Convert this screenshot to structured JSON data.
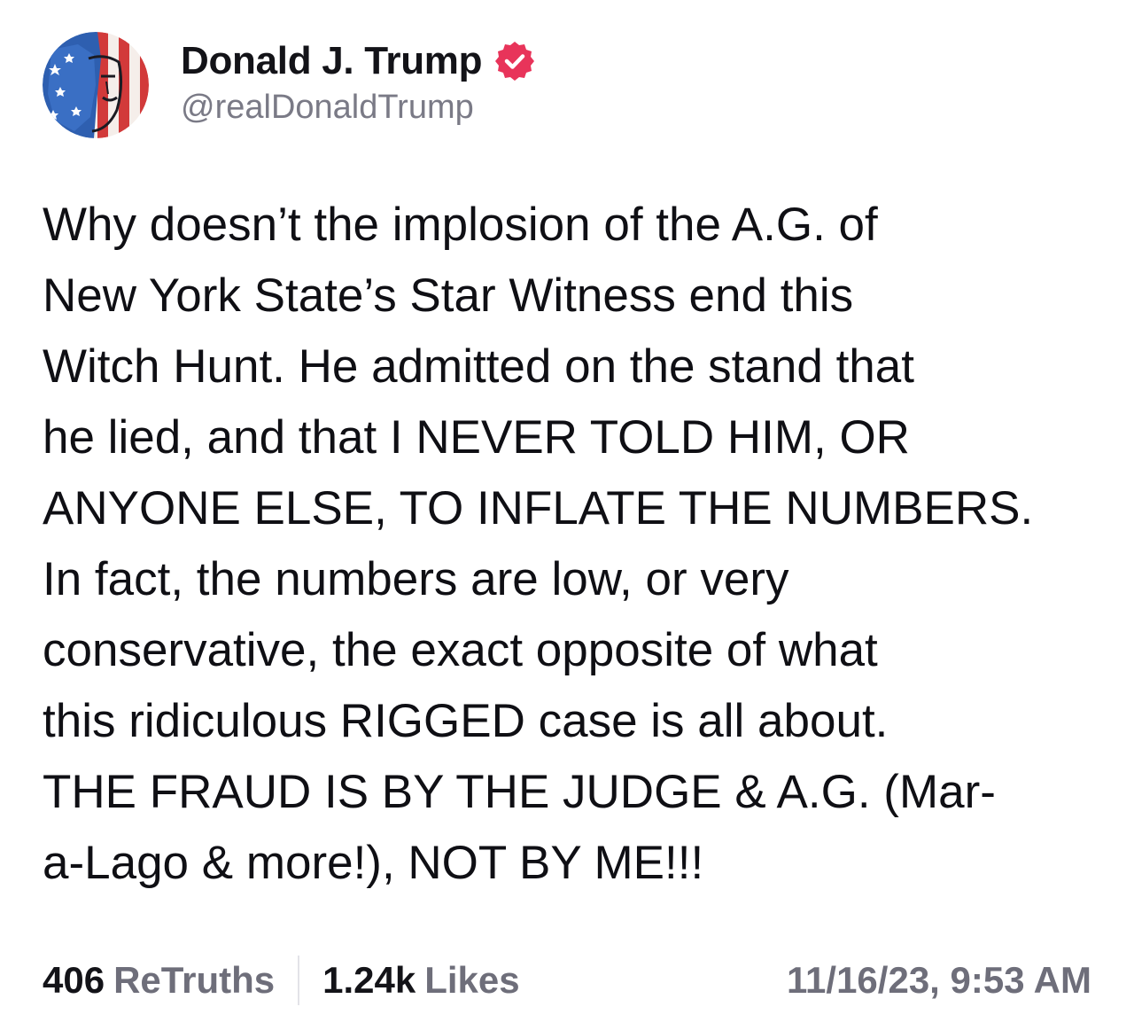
{
  "author": {
    "display_name": "Donald J. Trump",
    "handle": "@realDonaldTrump",
    "verified_icon": "verified-badge-icon",
    "verified_color": "#e8345a"
  },
  "post": {
    "text": "Why doesn’t the implosion of the A.G. of\nNew York State’s Star Witness end this\nWitch Hunt. He admitted on the stand that\nhe lied, and that I NEVER TOLD HIM, OR\nANYONE ELSE, TO INFLATE THE NUMBERS.\nIn fact, the numbers are low, or very\nconservative, the exact opposite of what\nthis ridiculous RIGGED case is all about.\nTHE FRAUD IS BY THE JUDGE & A.G. (Mar-\na-Lago & more!), NOT BY ME!!!"
  },
  "stats": {
    "retruths_count": "406",
    "retruths_label": "ReTruths",
    "likes_count": "1.24k",
    "likes_label": "Likes"
  },
  "timestamp": "11/16/23, 9:53 AM",
  "colors": {
    "text": "#0f0f14",
    "muted": "#6e6e7a",
    "handle": "#7a7a86",
    "divider": "#e3e3e8"
  }
}
